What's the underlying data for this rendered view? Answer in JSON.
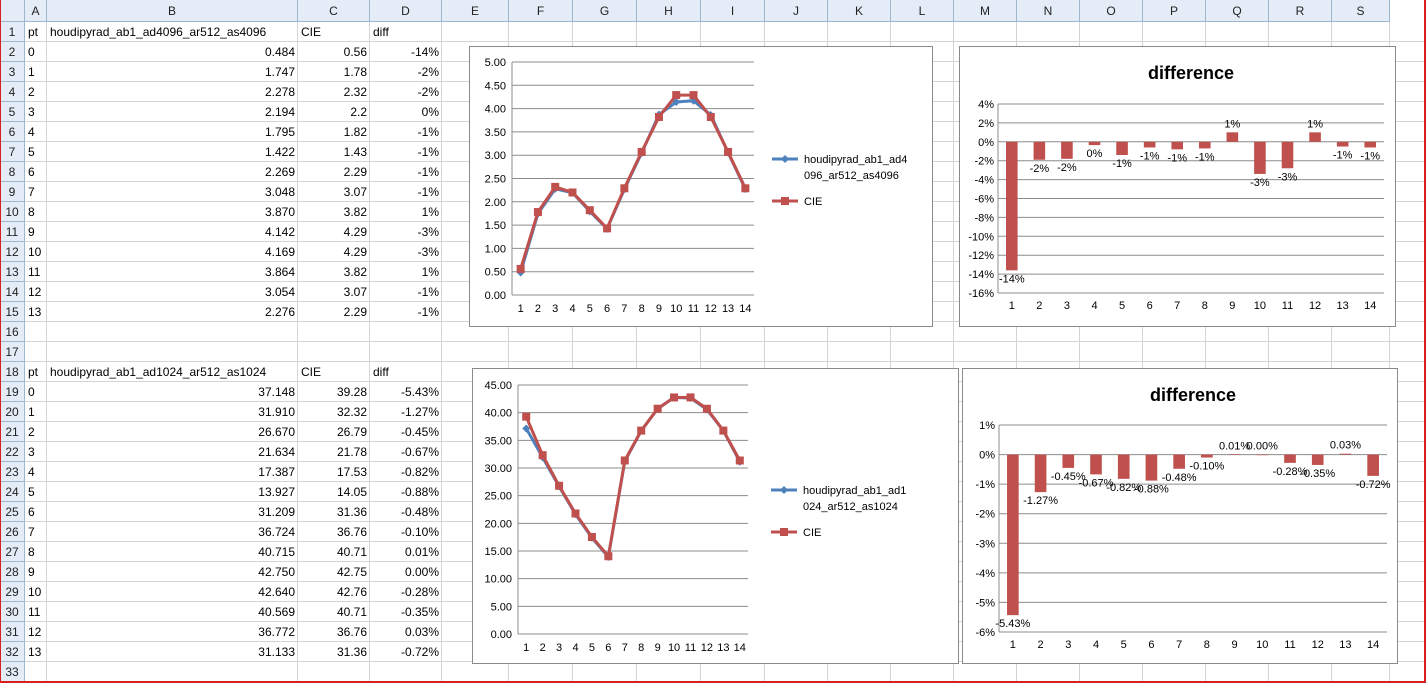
{
  "columns": [
    "A",
    "B",
    "C",
    "D",
    "E",
    "F",
    "G",
    "H",
    "I",
    "J",
    "K",
    "L",
    "M",
    "N",
    "O",
    "P",
    "Q",
    "R",
    "S"
  ],
  "rows": [
    "1",
    "2",
    "3",
    "4",
    "5",
    "6",
    "7",
    "8",
    "9",
    "10",
    "11",
    "12",
    "13",
    "14",
    "15",
    "16",
    "17",
    "18",
    "19",
    "20",
    "21",
    "22",
    "23",
    "24",
    "25",
    "26",
    "27",
    "28",
    "29",
    "30",
    "31",
    "32",
    "33"
  ],
  "table1": {
    "headers": [
      "pt",
      "houdipyrad_ab1_ad4096_ar512_as4096",
      "CIE",
      "diff"
    ],
    "rows": [
      [
        "0",
        "0.484",
        "0.56",
        "-14%"
      ],
      [
        "1",
        "1.747",
        "1.78",
        "-2%"
      ],
      [
        "2",
        "2.278",
        "2.32",
        "-2%"
      ],
      [
        "3",
        "2.194",
        "2.2",
        "0%"
      ],
      [
        "4",
        "1.795",
        "1.82",
        "-1%"
      ],
      [
        "5",
        "1.422",
        "1.43",
        "-1%"
      ],
      [
        "6",
        "2.269",
        "2.29",
        "-1%"
      ],
      [
        "7",
        "3.048",
        "3.07",
        "-1%"
      ],
      [
        "8",
        "3.870",
        "3.82",
        "1%"
      ],
      [
        "9",
        "4.142",
        "4.29",
        "-3%"
      ],
      [
        "10",
        "4.169",
        "4.29",
        "-3%"
      ],
      [
        "11",
        "3.864",
        "3.82",
        "1%"
      ],
      [
        "12",
        "3.054",
        "3.07",
        "-1%"
      ],
      [
        "13",
        "2.276",
        "2.29",
        "-1%"
      ]
    ]
  },
  "table2": {
    "headers": [
      "pt",
      "houdipyrad_ab1_ad1024_ar512_as1024",
      "CIE",
      "diff"
    ],
    "rows": [
      [
        "0",
        "37.148",
        "39.28",
        "-5.43%"
      ],
      [
        "1",
        "31.910",
        "32.32",
        "-1.27%"
      ],
      [
        "2",
        "26.670",
        "26.79",
        "-0.45%"
      ],
      [
        "3",
        "21.634",
        "21.78",
        "-0.67%"
      ],
      [
        "4",
        "17.387",
        "17.53",
        "-0.82%"
      ],
      [
        "5",
        "13.927",
        "14.05",
        "-0.88%"
      ],
      [
        "6",
        "31.209",
        "31.36",
        "-0.48%"
      ],
      [
        "7",
        "36.724",
        "36.76",
        "-0.10%"
      ],
      [
        "8",
        "40.715",
        "40.71",
        "0.01%"
      ],
      [
        "9",
        "42.750",
        "42.75",
        "0.00%"
      ],
      [
        "10",
        "42.640",
        "42.76",
        "-0.28%"
      ],
      [
        "11",
        "40.569",
        "40.71",
        "-0.35%"
      ],
      [
        "12",
        "36.772",
        "36.76",
        "0.03%"
      ],
      [
        "13",
        "31.133",
        "31.36",
        "-0.72%"
      ]
    ]
  },
  "colors": {
    "series_blue": "#4f81bd",
    "series_red": "#c0504d",
    "bar_red": "#c0504d"
  },
  "chart_data": [
    {
      "type": "line",
      "x": [
        "1",
        "2",
        "3",
        "4",
        "5",
        "6",
        "7",
        "8",
        "9",
        "10",
        "11",
        "12",
        "13",
        "14"
      ],
      "ylim": [
        0,
        5
      ],
      "yticks": [
        "0.00",
        "0.50",
        "1.00",
        "1.50",
        "2.00",
        "2.50",
        "3.00",
        "3.50",
        "4.00",
        "4.50",
        "5.00"
      ],
      "legend": [
        "houdipyrad_ab1_ad4",
        "096_ar512_as4096",
        "CIE"
      ],
      "legend_position": "right",
      "series": [
        {
          "name": "houdipyrad_ab1_ad4096_ar512_as4096",
          "values": [
            0.484,
            1.747,
            2.278,
            2.194,
            1.795,
            1.422,
            2.269,
            3.048,
            3.87,
            4.142,
            4.169,
            3.864,
            3.054,
            2.276
          ]
        },
        {
          "name": "CIE",
          "values": [
            0.56,
            1.78,
            2.32,
            2.2,
            1.82,
            1.43,
            2.29,
            3.07,
            3.82,
            4.29,
            4.29,
            3.82,
            3.07,
            2.29
          ]
        }
      ]
    },
    {
      "type": "bar",
      "title": "difference",
      "categories": [
        "1",
        "2",
        "3",
        "4",
        "5",
        "6",
        "7",
        "8",
        "9",
        "10",
        "11",
        "12",
        "13",
        "14"
      ],
      "values": [
        -13.6,
        -1.9,
        -1.8,
        -0.35,
        -1.4,
        -0.6,
        -0.8,
        -0.7,
        1.0,
        -3.4,
        -2.8,
        1.0,
        -0.5,
        -0.6
      ],
      "labels": [
        "-14%",
        "-2%",
        "-2%",
        "0%",
        "-1%",
        "-1%",
        "-1%",
        "-1%",
        "1%",
        "-3%",
        "-3%",
        "1%",
        "-1%",
        "-1%"
      ],
      "ylim": [
        -16,
        4
      ],
      "yticks": [
        "4%",
        "2%",
        "0%",
        "-2%",
        "-4%",
        "-6%",
        "-8%",
        "-10%",
        "-12%",
        "-14%",
        "-16%"
      ]
    },
    {
      "type": "line",
      "x": [
        "1",
        "2",
        "3",
        "4",
        "5",
        "6",
        "7",
        "8",
        "9",
        "10",
        "11",
        "12",
        "13",
        "14"
      ],
      "ylim": [
        0,
        45
      ],
      "yticks": [
        "0.00",
        "5.00",
        "10.00",
        "15.00",
        "20.00",
        "25.00",
        "30.00",
        "35.00",
        "40.00",
        "45.00"
      ],
      "legend": [
        "houdipyrad_ab1_ad1",
        "024_ar512_as1024",
        "CIE"
      ],
      "legend_position": "right",
      "series": [
        {
          "name": "houdipyrad_ab1_ad1024_ar512_as1024",
          "values": [
            37.148,
            31.91,
            26.67,
            21.634,
            17.387,
            13.927,
            31.209,
            36.724,
            40.715,
            42.75,
            42.64,
            40.569,
            36.772,
            31.133
          ]
        },
        {
          "name": "CIE",
          "values": [
            39.28,
            32.32,
            26.79,
            21.78,
            17.53,
            14.05,
            31.36,
            36.76,
            40.71,
            42.75,
            42.76,
            40.71,
            36.76,
            31.36
          ]
        }
      ]
    },
    {
      "type": "bar",
      "title": "difference",
      "categories": [
        "1",
        "2",
        "3",
        "4",
        "5",
        "6",
        "7",
        "8",
        "9",
        "10",
        "11",
        "12",
        "13",
        "14"
      ],
      "values": [
        -5.43,
        -1.27,
        -0.45,
        -0.67,
        -0.82,
        -0.88,
        -0.48,
        -0.1,
        0.01,
        0.0,
        -0.28,
        -0.35,
        0.03,
        -0.72
      ],
      "labels": [
        "-5.43%",
        "-1.27%",
        "-0.45%",
        "-0.67%",
        "-0.82%",
        "-0.88%",
        "-0.48%",
        "-0.10%",
        "0.01%",
        "0.00%",
        "-0.28%",
        "-0.35%",
        "0.03%",
        "-0.72%"
      ],
      "ylim": [
        -6,
        1
      ],
      "yticks": [
        "1%",
        "0%",
        "-1%",
        "-2%",
        "-3%",
        "-4%",
        "-5%",
        "-6%"
      ]
    }
  ]
}
